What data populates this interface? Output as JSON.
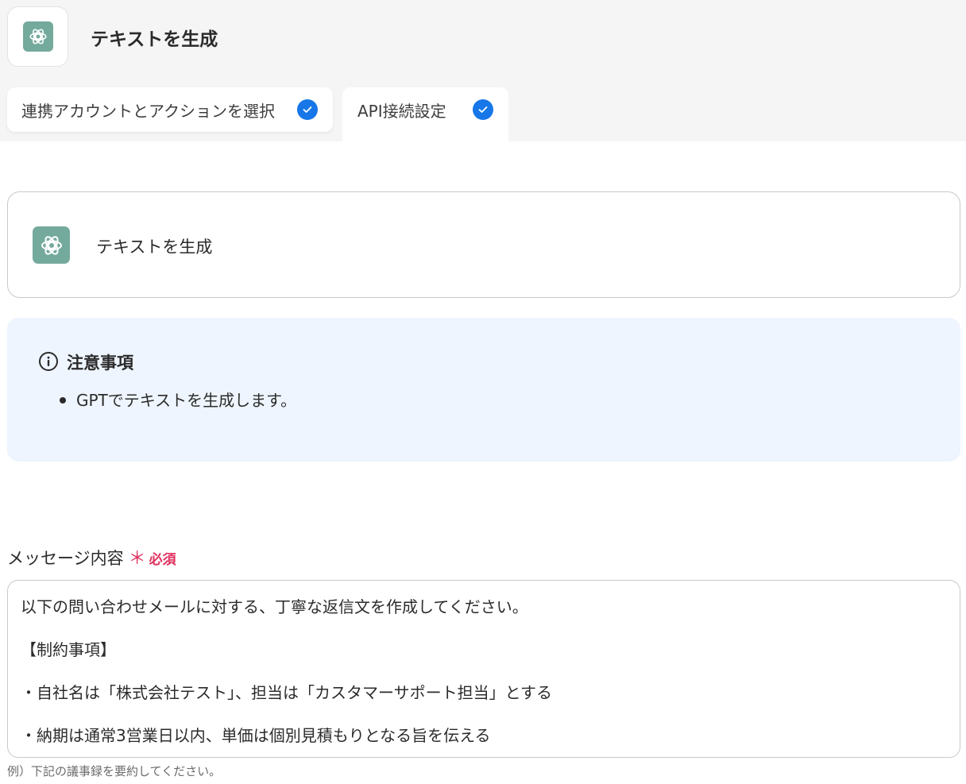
{
  "header": {
    "title": "テキストを生成",
    "app_icon": "openai-logo-icon"
  },
  "tabs": [
    {
      "label": "連携アカウントとアクションを選択",
      "completed": true
    },
    {
      "label": "API接続設定",
      "completed": true
    }
  ],
  "action": {
    "label": "テキストを生成",
    "icon": "openai-logo-icon"
  },
  "notice": {
    "title": "注意事項",
    "items": [
      "GPTでテキストを生成します。"
    ]
  },
  "message_field": {
    "label": "メッセージ内容",
    "required_mark": "＊",
    "required_text": "必須",
    "lines": [
      "以下の問い合わせメールに対する、丁寧な返信文を作成してください。",
      "【制約事項】",
      "・自社名は「株式会社テスト」、担当は「カスタマーサポート担当」とする",
      "・納期は通常3営業日以内、単価は個別見積もりとなる旨を伝える"
    ],
    "placeholder": "例）下記の議事録を要約してください。"
  },
  "colors": {
    "accent": "#1777e8",
    "required": "#e0315f",
    "notice_bg": "#eef5fe",
    "openai_brand": "#74aa9c"
  }
}
